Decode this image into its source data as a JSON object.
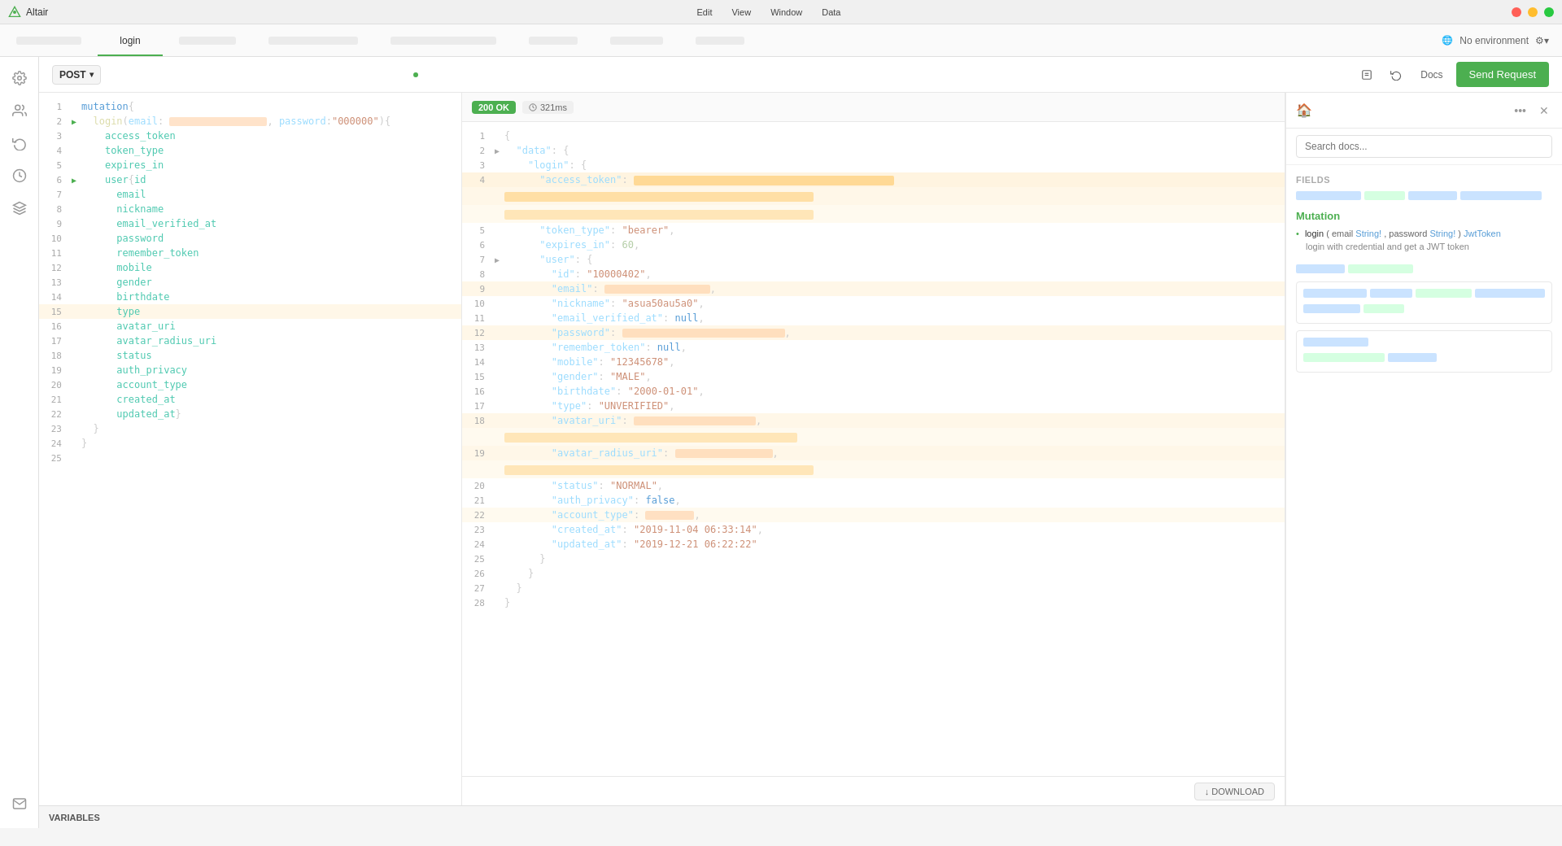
{
  "app": {
    "title": "Altair",
    "menu_items": [
      "Edit",
      "View",
      "Window",
      "Data"
    ],
    "window_controls": [
      "minimize",
      "maximize",
      "close"
    ]
  },
  "tabs": [
    {
      "id": "tab1",
      "label": "",
      "blurred": true,
      "active": false
    },
    {
      "id": "tab2",
      "label": "login",
      "blurred": false,
      "active": true
    },
    {
      "id": "tab3",
      "label": "",
      "blurred": true,
      "active": false
    },
    {
      "id": "tab4",
      "label": "",
      "blurred": true,
      "active": false
    },
    {
      "id": "tab5",
      "label": "",
      "blurred": true,
      "active": false
    },
    {
      "id": "tab6",
      "label": "",
      "blurred": true,
      "active": false
    },
    {
      "id": "tab7",
      "label": "",
      "blurred": true,
      "active": false
    },
    {
      "id": "tab8",
      "label": "",
      "blurred": true,
      "active": false
    }
  ],
  "env": {
    "label": "No environment",
    "settings": "⚙"
  },
  "request": {
    "method": "POST",
    "url_indicator": "●",
    "docs_label": "Docs",
    "send_label": "Send Request"
  },
  "query_editor": {
    "lines": [
      {
        "num": 1,
        "arrow": null,
        "content": "mutation{",
        "type": "normal"
      },
      {
        "num": 2,
        "arrow": "▶",
        "content": "  login(email: \"[redacted]\", password:\"000000\"){",
        "type": "normal"
      },
      {
        "num": 3,
        "arrow": null,
        "content": "    access_token",
        "type": "normal"
      },
      {
        "num": 4,
        "arrow": null,
        "content": "    token_type",
        "type": "normal"
      },
      {
        "num": 5,
        "arrow": null,
        "content": "    expires_in",
        "type": "normal"
      },
      {
        "num": 6,
        "arrow": "▶",
        "content": "    user{id",
        "type": "normal"
      },
      {
        "num": 7,
        "arrow": null,
        "content": "      email",
        "type": "normal"
      },
      {
        "num": 8,
        "arrow": null,
        "content": "      nickname",
        "type": "normal"
      },
      {
        "num": 9,
        "arrow": null,
        "content": "      email_verified_at",
        "type": "normal"
      },
      {
        "num": 10,
        "arrow": null,
        "content": "      password",
        "type": "normal"
      },
      {
        "num": 11,
        "arrow": null,
        "content": "      remember_token",
        "type": "normal"
      },
      {
        "num": 12,
        "arrow": null,
        "content": "      mobile",
        "type": "normal"
      },
      {
        "num": 13,
        "arrow": null,
        "content": "      gender",
        "type": "normal"
      },
      {
        "num": 14,
        "arrow": null,
        "content": "      birthdate",
        "type": "normal"
      },
      {
        "num": 15,
        "arrow": null,
        "content": "      type",
        "type": "normal"
      },
      {
        "num": 16,
        "arrow": null,
        "content": "      avatar_uri",
        "type": "normal"
      },
      {
        "num": 17,
        "arrow": null,
        "content": "      avatar_radius_uri",
        "type": "normal"
      },
      {
        "num": 18,
        "arrow": null,
        "content": "      status",
        "type": "normal"
      },
      {
        "num": 19,
        "arrow": null,
        "content": "      auth_privacy",
        "type": "normal"
      },
      {
        "num": 20,
        "arrow": null,
        "content": "      account_type",
        "type": "normal"
      },
      {
        "num": 21,
        "arrow": null,
        "content": "      created_at",
        "type": "normal"
      },
      {
        "num": 22,
        "arrow": null,
        "content": "      updated_at}",
        "type": "normal"
      },
      {
        "num": 23,
        "arrow": null,
        "content": "  }",
        "type": "normal"
      },
      {
        "num": 24,
        "arrow": null,
        "content": "}",
        "type": "normal"
      },
      {
        "num": 25,
        "arrow": null,
        "content": "",
        "type": "normal"
      }
    ]
  },
  "response": {
    "status": "200 OK",
    "time": "321ms",
    "download_label": "↓ DOWNLOAD",
    "lines": [
      {
        "num": 1,
        "text": "{"
      },
      {
        "num": 2,
        "text": "  \"data\": {",
        "bold": false
      },
      {
        "num": 3,
        "text": "    \"login\": {"
      },
      {
        "num": 4,
        "text": "      \"access_token\":",
        "redacted": true
      },
      {
        "num": 5,
        "text": "      \"token_type\": \"bearer\","
      },
      {
        "num": 6,
        "text": "      \"expires_in\": 60,"
      },
      {
        "num": 7,
        "text": "      \"user\": {"
      },
      {
        "num": 8,
        "text": "        \"id\": \"10000402\","
      },
      {
        "num": 9,
        "text": "        \"email\":",
        "redacted": true
      },
      {
        "num": 10,
        "text": "        \"nickname\": \"asua50au5a0\","
      },
      {
        "num": 11,
        "text": "        \"email_verified_at\": null,"
      },
      {
        "num": 12,
        "text": "        \"password\":",
        "redacted": true
      },
      {
        "num": 13,
        "text": "        \"remember_token\": null,"
      },
      {
        "num": 14,
        "text": "        \"mobile\": \"12345678\","
      },
      {
        "num": 15,
        "text": "        \"gender\": \"MALE\","
      },
      {
        "num": 16,
        "text": "        \"birthdate\": \"2000-01-01\","
      },
      {
        "num": 17,
        "text": "        \"type\": \"UNVERIFIED\","
      },
      {
        "num": 18,
        "text": "        \"avatar_uri\":",
        "redacted": true
      },
      {
        "num": 19,
        "text": "        \"avatar_radius_uri\":",
        "redacted": true
      },
      {
        "num": 20,
        "text": "        \"status\": \"NORMAL\","
      },
      {
        "num": 21,
        "text": "        \"auth_privacy\": false,"
      },
      {
        "num": 22,
        "text": "        \"account_type\":",
        "redacted": true
      },
      {
        "num": 23,
        "text": "        \"created_at\": \"2019-11-04 06:33:14\","
      },
      {
        "num": 24,
        "text": "        \"updated_at\": \"2019-12-21 06:22:22\""
      },
      {
        "num": 25,
        "text": "      }"
      },
      {
        "num": 26,
        "text": "    }"
      },
      {
        "num": 27,
        "text": "  }"
      },
      {
        "num": 28,
        "text": "}"
      }
    ]
  },
  "docs": {
    "search_placeholder": "Search docs...",
    "fields_label": "FIELDS",
    "mutation_label": "Mutation",
    "entry": {
      "prefix": "login",
      "params": "( email String!, password String! )",
      "return": "JwtToken",
      "desc": "login with credential and get a JWT token"
    }
  },
  "variables": {
    "label": "VARIABLES"
  },
  "sidebar_icons": [
    {
      "id": "settings",
      "symbol": "⚙"
    },
    {
      "id": "team",
      "symbol": "👥"
    },
    {
      "id": "refresh",
      "symbol": "↺"
    },
    {
      "id": "history",
      "symbol": "🕐"
    },
    {
      "id": "plugins",
      "symbol": "🔧"
    },
    {
      "id": "mail",
      "symbol": "✉"
    }
  ]
}
